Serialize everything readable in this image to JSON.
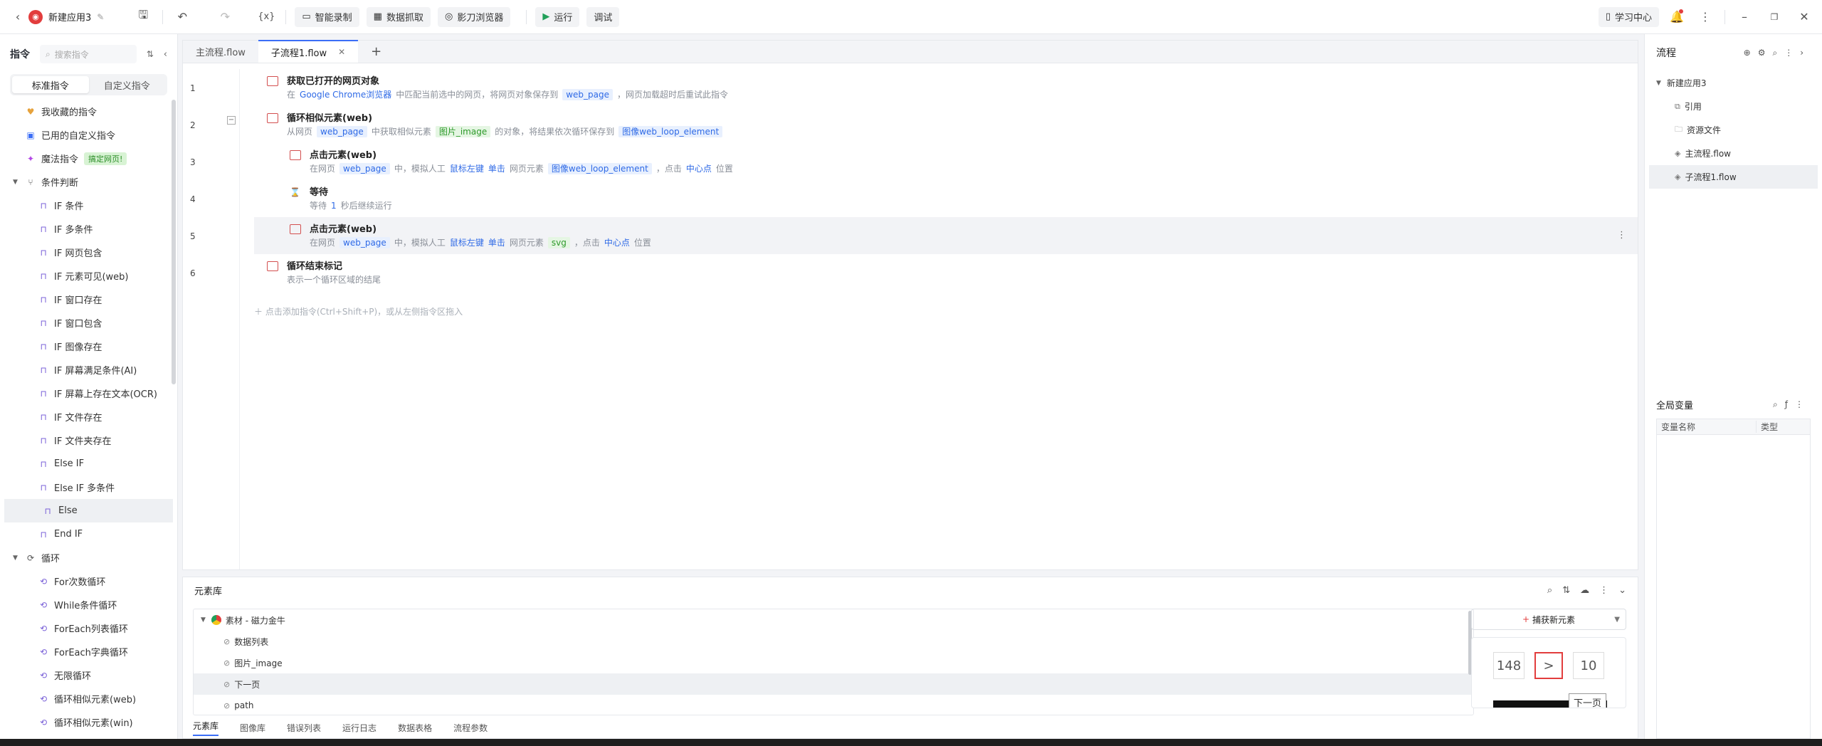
{
  "topbar": {
    "app_name": "新建应用3",
    "buttons": {
      "smart_record": "智能录制",
      "data_grab": "数据抓取",
      "yingdao_browser": "影刀浏览器",
      "run": "运行",
      "debug": "调试"
    },
    "learning_center": "学习中心"
  },
  "left": {
    "title": "指令",
    "search_placeholder": "搜索指令",
    "tabs": {
      "standard": "标准指令",
      "custom": "自定义指令"
    },
    "items": [
      {
        "label": "我收藏的指令"
      },
      {
        "label": "已用的自定义指令"
      },
      {
        "label": "魔法指令",
        "tag": "搞定网页!"
      }
    ],
    "groups": [
      {
        "label": "条件判断",
        "items": [
          "IF 条件",
          "IF 多条件",
          "IF 网页包含",
          "IF 元素可见(web)",
          "IF 窗口存在",
          "IF 窗口包含",
          "IF 图像存在",
          "IF 屏幕满足条件(AI)",
          "IF 屏幕上存在文本(OCR)",
          "IF 文件存在",
          "IF 文件夹存在",
          "Else IF",
          "Else IF 多条件",
          "Else",
          "End IF"
        ]
      },
      {
        "label": "循环",
        "items": [
          "For次数循环",
          "While条件循环",
          "ForEach列表循环",
          "ForEach字典循环",
          "无限循环",
          "循环相似元素(web)",
          "循环相似元素(win)"
        ]
      }
    ]
  },
  "editor": {
    "tabs": [
      {
        "label": "主流程.flow"
      },
      {
        "label": "子流程1.flow"
      }
    ],
    "steps": [
      {
        "num": "1",
        "title": "获取已打开的网页对象",
        "desc": {
          "a": "在",
          "b": "Google Chrome浏览器",
          "c": "中匹配当前选中的网页，将网页对象保存到",
          "d": "web_page",
          "e": "，网页加载超时后重试此指令"
        }
      },
      {
        "num": "2",
        "title": "循环相似元素(web)",
        "desc": {
          "a": "从网页",
          "b": "web_page",
          "c": "中获取相似元素",
          "d": "图片_image",
          "e": "的对象，将结果依次循环保存到",
          "f": "图像web_loop_element"
        }
      },
      {
        "num": "3",
        "title": "点击元素(web)",
        "desc": {
          "a": "在网页",
          "b": "web_page",
          "c": "中，模拟人工",
          "d": "鼠标左键",
          "e": "单击",
          "f": "网页元素",
          "g": "图像web_loop_element",
          "h": "，点击",
          "i": "中心点",
          "j": "位置"
        }
      },
      {
        "num": "4",
        "title": "等待",
        "desc": {
          "a": "等待",
          "b": "1",
          "c": "秒后继续运行"
        }
      },
      {
        "num": "5",
        "title": "点击元素(web)",
        "desc": {
          "a": "在网页",
          "b": "web_page",
          "c": "中，模拟人工",
          "d": "鼠标左键",
          "e": "单击",
          "f": "网页元素",
          "g": "svg",
          "h": "，点击",
          "i": "中心点",
          "j": "位置"
        }
      },
      {
        "num": "6",
        "title": "循环结束标记",
        "desc": {
          "a": "表示一个循环区域的结尾"
        }
      }
    ],
    "add_hint": "点击添加指令(Ctrl+Shift+P)，或从左侧指令区拖入"
  },
  "library": {
    "title": "元素库",
    "root": "素材 - 磁力金牛",
    "items": [
      "数据列表",
      "图片_image",
      "下一页",
      "path"
    ],
    "capture": "捕获新元素",
    "preview": {
      "num_left": "148",
      "arrow": ">",
      "num_right": "10",
      "tooltip": "下一页"
    },
    "tabs": [
      "元素库",
      "图像库",
      "错误列表",
      "运行日志",
      "数据表格",
      "流程参数"
    ]
  },
  "right": {
    "title": "流程",
    "root": "新建应用3",
    "items": [
      "引用",
      "资源文件",
      "主流程.flow",
      "子流程1.flow"
    ],
    "globals_title": "全局变量",
    "col_name": "变量名称",
    "col_type": "类型"
  },
  "colors": {
    "accent": "#3b6ef6",
    "run": "#22a05a"
  }
}
